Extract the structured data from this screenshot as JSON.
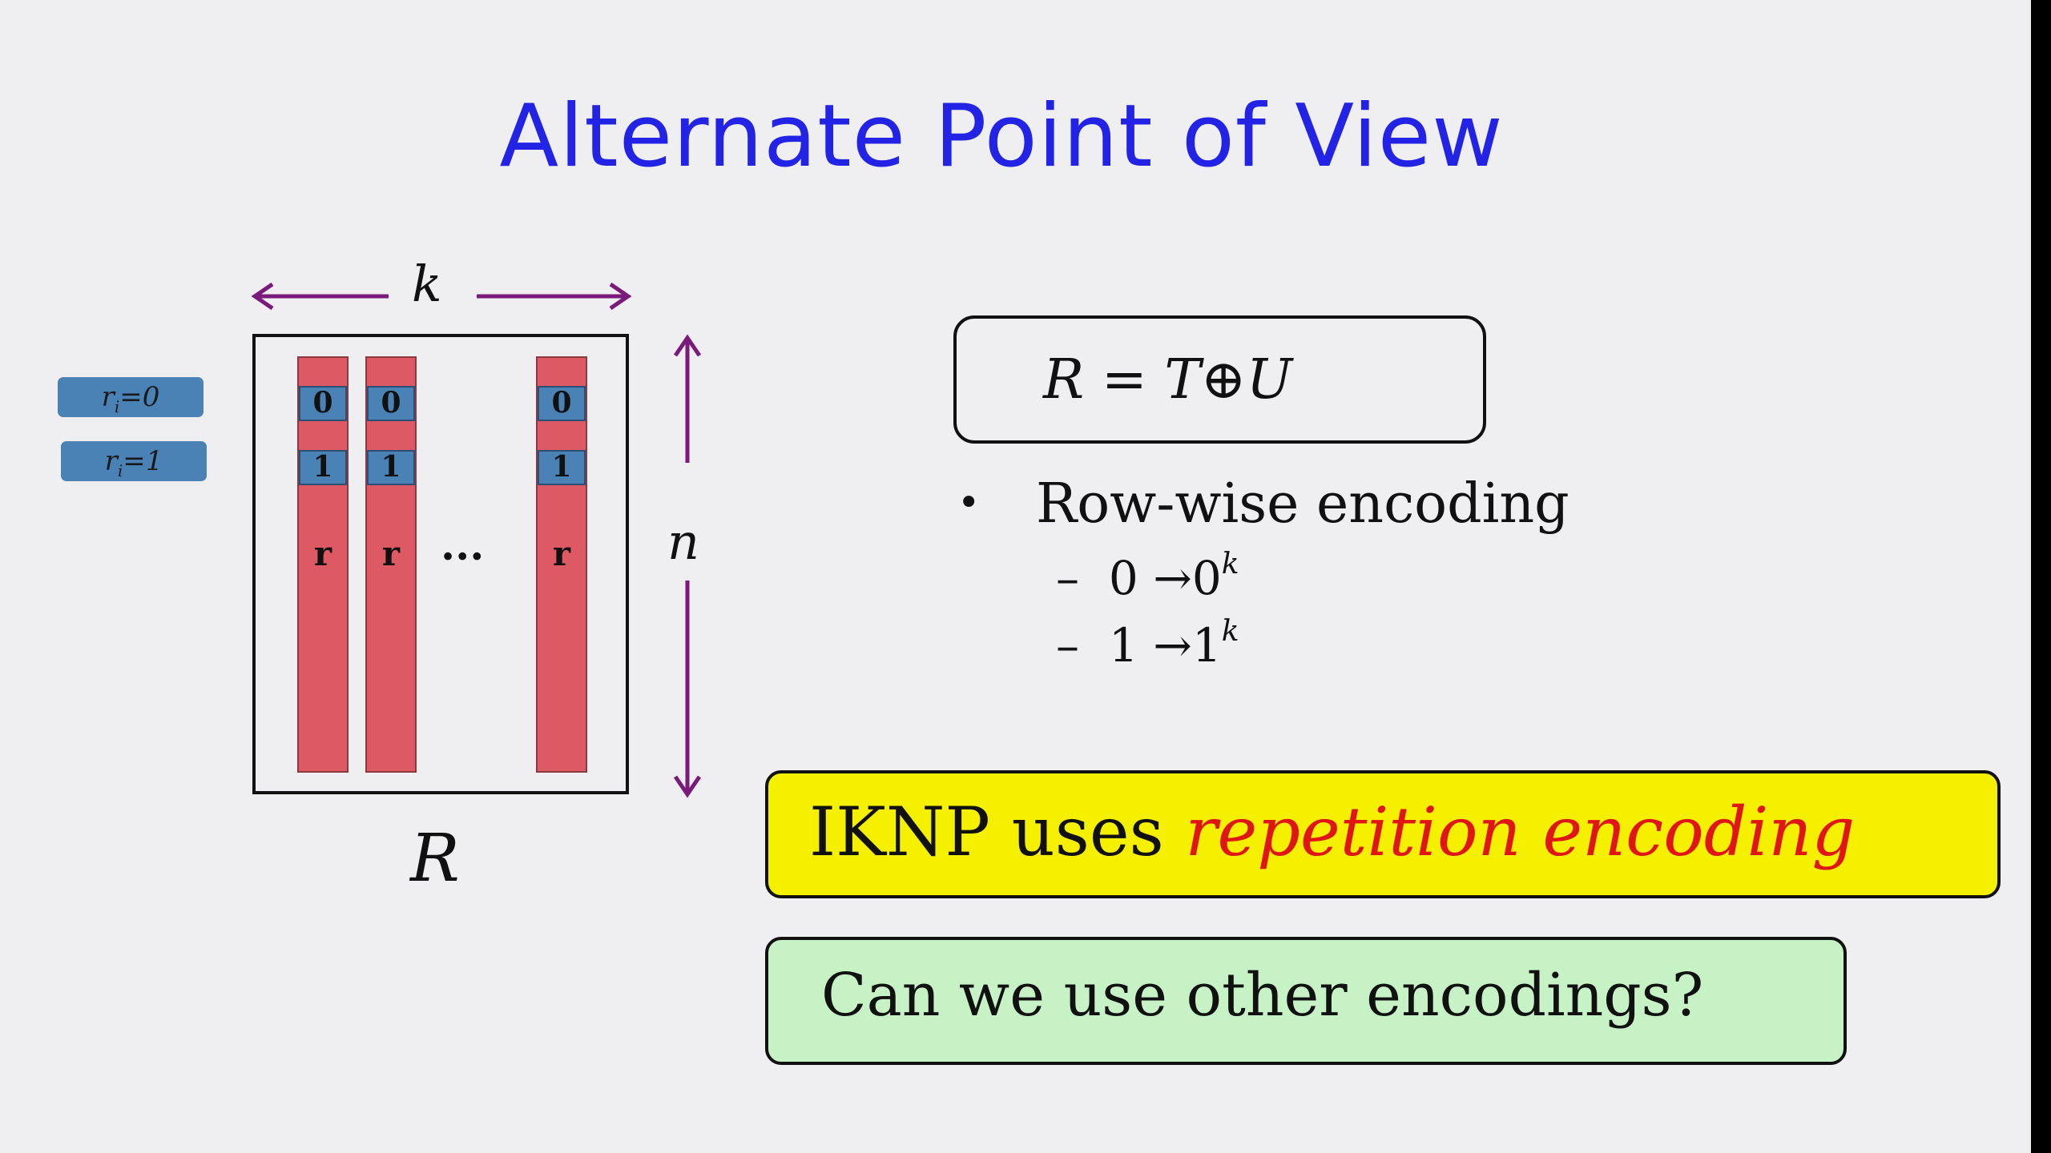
{
  "slide": {
    "title": "Alternate Point of View",
    "diagram": {
      "width_label": "k",
      "height_label": "n",
      "matrix_label": "R",
      "row_tags": {
        "zero": {
          "var": "r",
          "sub": "i",
          "value": "=0"
        },
        "one": {
          "var": "r",
          "sub": "i",
          "value": "=1"
        }
      },
      "columns": [
        {
          "top": "0",
          "bottom": "1",
          "label": "r"
        },
        {
          "top": "0",
          "bottom": "1",
          "label": "r"
        },
        {
          "top": "0",
          "bottom": "1",
          "label": "r"
        }
      ],
      "ellipsis": "···"
    },
    "equation": "R = T⊕U",
    "bullet": {
      "text": "Row-wise encoding",
      "subitems": [
        {
          "dash": "–",
          "from": "0",
          "arrow": "→",
          "to": "0",
          "exp": "k"
        },
        {
          "dash": "–",
          "from": "1",
          "arrow": "→",
          "to": "1",
          "exp": "k"
        }
      ]
    },
    "callout_yellow": {
      "prefix": "IKNP uses ",
      "emphasis": "repetition encoding"
    },
    "callout_green": {
      "text": "Can we use other encodings?"
    }
  },
  "colors": {
    "background": "#efeef0",
    "title": "#2323e6",
    "arrows": "#7a1a7a",
    "column_fill": "#dd5a64",
    "cell_fill": "#4a82b5",
    "yellow": "#f5f000",
    "emphasis_red": "#e01616",
    "green": "#c6f2c6"
  }
}
